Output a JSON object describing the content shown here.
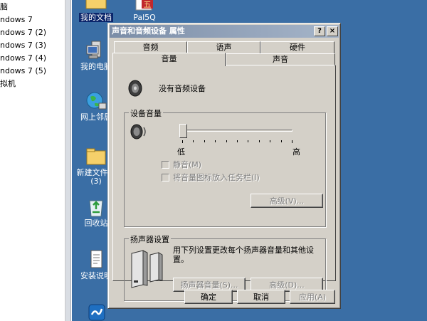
{
  "host_panel": {
    "items": [
      "脑",
      "ndows 7",
      "ndows 7 (2)",
      "ndows 7 (3)",
      "ndows 7 (4)",
      "ndows 7 (5)",
      "拟机"
    ]
  },
  "desktop": {
    "icons": {
      "my_documents": "我的文档",
      "pal5q": "Pal5Q",
      "my_computer": "我的电脑",
      "network": "网上邻居",
      "new_folder": "新建文件夹",
      "new_folder_count": "(3)",
      "recycle_bin": "回收站",
      "install_guide": "安装说明"
    },
    "pal5q_badge": "五"
  },
  "dialog": {
    "title": "声音和音频设备 属性",
    "help_btn": "?",
    "close_btn": "×",
    "tabs_row1": [
      "音频",
      "语声",
      "硬件"
    ],
    "tabs_row2": [
      "音量",
      "声音"
    ],
    "no_device_text": "没有音频设备",
    "device_volume": {
      "title": "设备音量",
      "low": "低",
      "high": "高",
      "volume_level": 0,
      "mute_label": "静音(M)",
      "tray_label": "将音量图标放入任务栏(I)",
      "advanced_btn": "高级(V)..."
    },
    "speaker_settings": {
      "title": "扬声器设置",
      "description": "用下列设置更改每个扬声器音量和其他设置。",
      "speaker_volume_btn": "扬声器音量(S)...",
      "advanced_btn": "高级(D)..."
    },
    "footer": {
      "ok": "确定",
      "cancel": "取消",
      "apply": "应用(A)"
    }
  },
  "colors": {
    "desktop": "#3a6ea5",
    "dialog_face": "#d4d0c8",
    "titlebar_inactive": "#7b8da7"
  }
}
